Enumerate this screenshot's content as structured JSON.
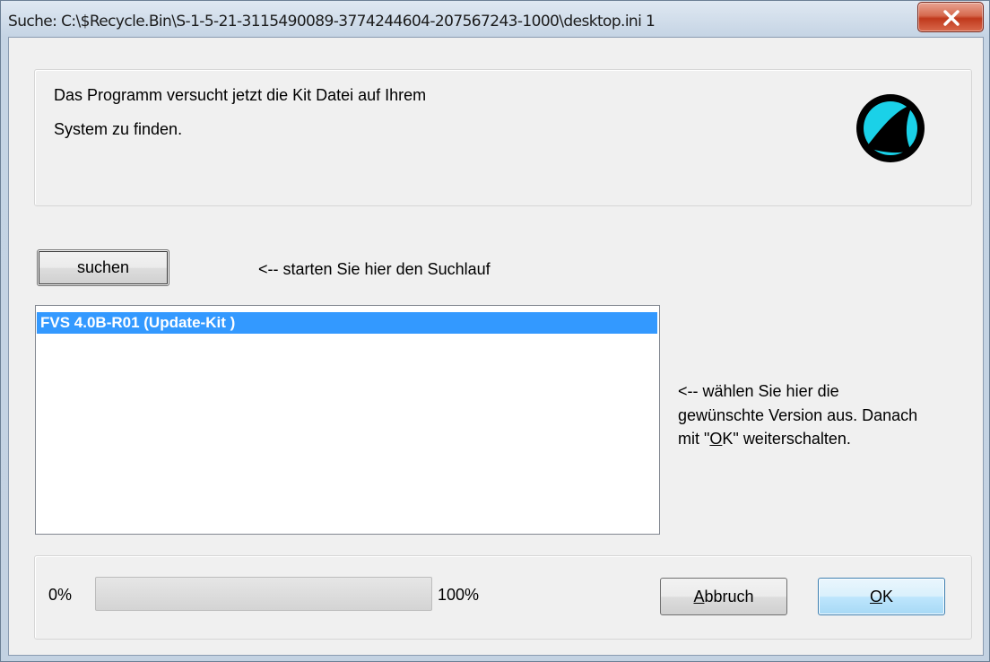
{
  "window": {
    "title": "Suche: C:\\$Recycle.Bin\\S-1-5-21-3115490089-3774244604-207567243-1000\\desktop.ini 1",
    "close_label": "x"
  },
  "header": {
    "line1": "Das Programm versucht jetzt die Kit Datei auf Ihrem",
    "line2": "System zu finden.",
    "logo": "shark-fin-logo"
  },
  "search": {
    "button_label": "suchen",
    "hint": "<-- starten Sie hier den Suchlauf"
  },
  "versions": {
    "items": [
      "FVS 4.0B-R01 (Update-Kit )"
    ],
    "selected": 0
  },
  "select_hint": {
    "line1": "<-- wählen Sie hier die",
    "line2": "gewünschte Version aus. Danach",
    "line3_pre": "mit \"",
    "line3_accel": "O",
    "line3_mid": "K",
    "line3_post": "\" weiterschalten."
  },
  "progress": {
    "min_label": "0%",
    "max_label": "100%",
    "value": 0
  },
  "buttons": {
    "cancel_accel": "A",
    "cancel_rest": "bbruch",
    "ok_accel": "O",
    "ok_rest": "K"
  },
  "colors": {
    "selection": "#3399ff",
    "logo_ring": "#1ad1e8",
    "logo_body": "#000000"
  }
}
